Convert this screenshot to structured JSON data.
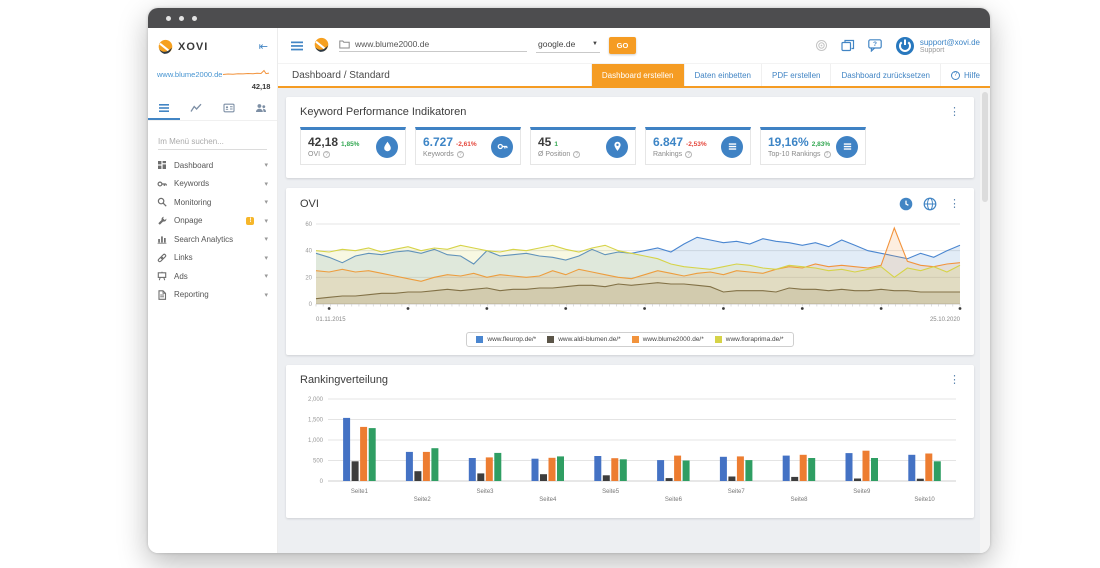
{
  "window": {
    "title_dots": 3
  },
  "sidebar": {
    "logo_text": "XOVI",
    "collapse_icon": "⇤",
    "domain": "www.blume2000.de",
    "domain_score": "42,18",
    "search_placeholder": "Im Menü suchen...",
    "tabs": [
      "menu",
      "trends",
      "profile-card",
      "users"
    ],
    "items": [
      {
        "label": "Dashboard"
      },
      {
        "label": "Keywords"
      },
      {
        "label": "Monitoring"
      },
      {
        "label": "Onpage",
        "badge": "!"
      },
      {
        "label": "Search Analytics"
      },
      {
        "label": "Links"
      },
      {
        "label": "Ads"
      },
      {
        "label": "Reporting"
      }
    ]
  },
  "header": {
    "url_value": "www.blume2000.de",
    "engine": "google.de",
    "go_label": "GO",
    "account_email": "support@xovi.de",
    "account_role": "Support"
  },
  "breadcrumb": {
    "path": "Dashboard / Standard",
    "buttons": [
      {
        "label": "Dashboard erstellen",
        "active": true
      },
      {
        "label": "Daten einbetten",
        "active": false
      },
      {
        "label": "PDF erstellen",
        "active": false
      },
      {
        "label": "Dashboard zurücksetzen",
        "active": false
      },
      {
        "label": "Hilfe",
        "active": false
      }
    ]
  },
  "kpi": {
    "title": "Keyword Performance Indikatoren",
    "cards": [
      {
        "value": "42,18",
        "delta": "1,85%",
        "trend": "up",
        "label": "OVI",
        "icon": "drop"
      },
      {
        "value": "6.727",
        "delta": "-2,61%",
        "trend": "down",
        "label": "Keywords",
        "icon": "key"
      },
      {
        "value": "45",
        "delta": "1",
        "trend": "up",
        "label": "Ø Position",
        "icon": "pin"
      },
      {
        "value": "6.847",
        "delta": "-2,53%",
        "trend": "down",
        "label": "Rankings",
        "icon": "list"
      },
      {
        "value": "19,16%",
        "delta": "2,83%",
        "trend": "up",
        "label": "Top-10 Rankings",
        "icon": "list"
      }
    ]
  },
  "ovi_panel": {
    "title": "OVI"
  },
  "ranking_panel": {
    "title": "Rankingverteilung"
  },
  "colors": {
    "accent_orange": "#f59c23",
    "link_blue": "#4285c4",
    "kpi_icon_blue": "#3f82c4",
    "delta_green": "#34a853",
    "delta_red": "#e5483d",
    "content_bg": "#edeff2"
  },
  "chart_data": [
    {
      "type": "line",
      "title": "OVI",
      "x_start_label": "01.11.2015",
      "x_end_label": "25.10.2020",
      "ylim": [
        0,
        60
      ],
      "yticks": [
        0,
        20,
        40,
        60
      ],
      "grid": true,
      "legend_position": "bottom",
      "series": [
        {
          "name": "www.fleurop.de/*",
          "color": "#4a86d0",
          "values": [
            38,
            35,
            31,
            36,
            38,
            37,
            39,
            40,
            38,
            41,
            37,
            36,
            30,
            40,
            36,
            37,
            38,
            36,
            35,
            33,
            36,
            41,
            37,
            39,
            38,
            40,
            42,
            39,
            45,
            50,
            48,
            46,
            47,
            45,
            49,
            47,
            46,
            44,
            46,
            43,
            48,
            44,
            40,
            38,
            36,
            34,
            38,
            35,
            40,
            44
          ]
        },
        {
          "name": "www.aldi-blumen.de/*",
          "color": "#5b5548",
          "values": [
            4,
            5,
            6,
            6,
            7,
            8,
            8,
            9,
            9,
            10,
            11,
            10,
            11,
            12,
            10,
            11,
            11,
            12,
            12,
            13,
            14,
            14,
            13,
            15,
            14,
            15,
            16,
            15,
            15,
            14,
            13,
            9,
            10,
            10,
            10,
            9,
            12,
            11,
            11,
            10,
            11,
            10,
            10,
            11,
            10,
            10,
            9,
            9,
            9,
            9
          ]
        },
        {
          "name": "www.blume2000.de/*",
          "color": "#f2933c",
          "values": [
            25,
            24,
            26,
            24,
            25,
            23,
            21,
            19,
            17,
            20,
            22,
            21,
            23,
            20,
            22,
            21,
            20,
            21,
            25,
            22,
            26,
            24,
            22,
            20,
            19,
            22,
            25,
            23,
            21,
            23,
            24,
            22,
            25,
            24,
            23,
            26,
            28,
            27,
            30,
            28,
            29,
            28,
            27,
            29,
            57,
            32,
            29,
            28,
            30,
            31
          ]
        },
        {
          "name": "www.floraprima.de/*",
          "color": "#d6d348",
          "values": [
            40,
            39,
            41,
            40,
            42,
            39,
            41,
            43,
            40,
            42,
            41,
            44,
            42,
            40,
            39,
            41,
            40,
            42,
            44,
            41,
            39,
            42,
            44,
            40,
            38,
            36,
            34,
            30,
            28,
            27,
            26,
            28,
            30,
            29,
            27,
            26,
            29,
            28,
            27,
            25,
            26,
            24,
            26,
            28,
            20,
            27,
            25,
            28,
            24,
            29
          ]
        }
      ]
    },
    {
      "type": "bar",
      "title": "Rankingverteilung",
      "categories": [
        "Seite1",
        "Seite2",
        "Seite3",
        "Seite4",
        "Seite5",
        "Seite6",
        "Seite7",
        "Seite8",
        "Seite9",
        "Seite10"
      ],
      "ylim": [
        0,
        2000
      ],
      "yticks": [
        0,
        500,
        1000,
        1500,
        2000
      ],
      "grid": true,
      "series": [
        {
          "color": "#4472c4",
          "values": [
            1540,
            710,
            560,
            545,
            610,
            510,
            590,
            620,
            680,
            640
          ]
        },
        {
          "color": "#3d3d3d",
          "values": [
            480,
            240,
            185,
            165,
            140,
            70,
            110,
            100,
            60,
            55
          ]
        },
        {
          "color": "#ed7d31",
          "values": [
            1320,
            710,
            575,
            565,
            555,
            620,
            600,
            640,
            740,
            670
          ]
        },
        {
          "color": "#2f9e63",
          "values": [
            1290,
            800,
            685,
            600,
            530,
            500,
            510,
            560,
            560,
            480
          ]
        }
      ]
    }
  ]
}
